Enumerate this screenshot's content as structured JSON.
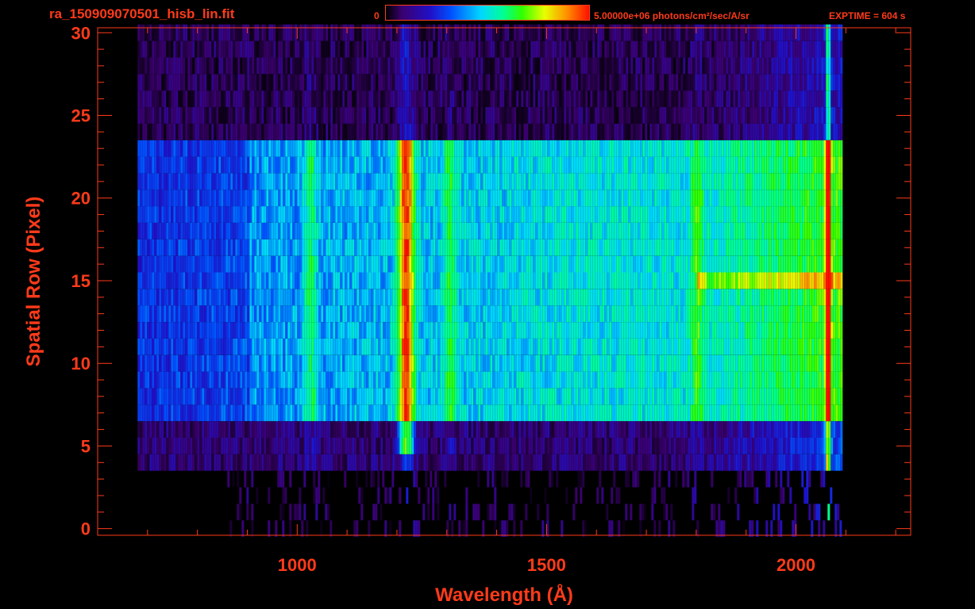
{
  "header": {
    "filename": "ra_150909070501_hisb_lin.fit",
    "colorbar_min": "0",
    "colorbar_max_label": "5.00000e+06 photons/cm²/sec/A/sr",
    "exptime": "EXPTIME = 604 s"
  },
  "colors": {
    "text": "#ff3a1a",
    "frame": "#ff3a1a",
    "background": "#000000",
    "colormap": [
      "#000000",
      "#3a0070",
      "#2010c8",
      "#0050ff",
      "#00d8ff",
      "#00ff90",
      "#30ff00",
      "#e8ff00",
      "#ff9000",
      "#ff1000"
    ]
  },
  "chart_data": {
    "type": "heatmap",
    "title": "ra_150909070501_hisb_lin.fit",
    "xlabel": "Wavelength (Å)",
    "ylabel": "Spatial Row (Pixel)",
    "xlim": [
      600,
      2230
    ],
    "ylim": [
      -0.4,
      30.3
    ],
    "x_ticks": [
      1000,
      1500,
      2000
    ],
    "x_tick_labels": [
      "1000",
      "1500",
      "2000"
    ],
    "y_ticks": [
      0,
      5,
      10,
      15,
      20,
      25,
      30
    ],
    "y_tick_labels": [
      "0",
      "5",
      "10",
      "15",
      "20",
      "25",
      "30"
    ],
    "colorbar": {
      "min": 0,
      "max": 5000000,
      "units": "photons/cm²/sec/A/sr"
    },
    "exptime_s": 604,
    "rows": 31,
    "emission_features_wavelength": [
      1025,
      1216,
      1304,
      1800,
      2062
    ],
    "detector_coverage_wavelength": [
      680,
      2090
    ],
    "bright_row_range": [
      7,
      23
    ]
  }
}
